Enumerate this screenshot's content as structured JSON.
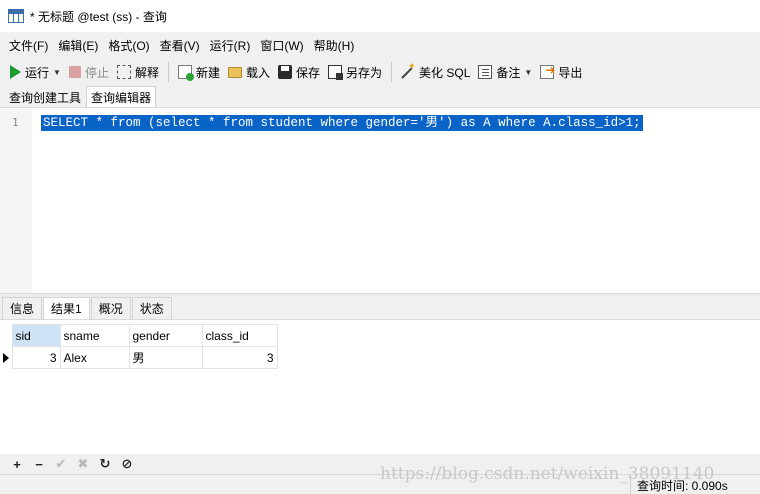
{
  "window": {
    "title": "* 无标题 @test (ss) - 查询"
  },
  "menu": {
    "items": [
      "文件(F)",
      "编辑(E)",
      "格式(O)",
      "查看(V)",
      "运行(R)",
      "窗口(W)",
      "帮助(H)"
    ]
  },
  "toolbar": {
    "run_label": "运行",
    "stop_label": "停止",
    "explain_label": "解释",
    "new_label": "新建",
    "load_label": "载入",
    "save_label": "保存",
    "saveas_label": "另存为",
    "beautify_label": "美化 SQL",
    "note_label": "备注",
    "export_label": "导出"
  },
  "subtabs": {
    "builder": "查询创建工具",
    "editor": "查询编辑器"
  },
  "editor": {
    "line_number": "1",
    "sql": "SELECT * from (select * from student where gender='男') as A where A.class_id>1;"
  },
  "result_tabs": {
    "info": "信息",
    "result1": "结果1",
    "profile": "概况",
    "status": "状态"
  },
  "grid": {
    "columns": [
      "sid",
      "sname",
      "gender",
      "class_id"
    ],
    "rows": [
      [
        "3",
        "Alex",
        "男",
        "3"
      ]
    ]
  },
  "bottom_tools": {
    "add": "+",
    "remove": "−",
    "apply": "✔",
    "discard": "✖",
    "refresh": "↻",
    "stop": "⊘"
  },
  "status": {
    "query_time": "查询时间: 0.090s"
  },
  "watermark": "https://blog.csdn.net/weixin_38091140"
}
